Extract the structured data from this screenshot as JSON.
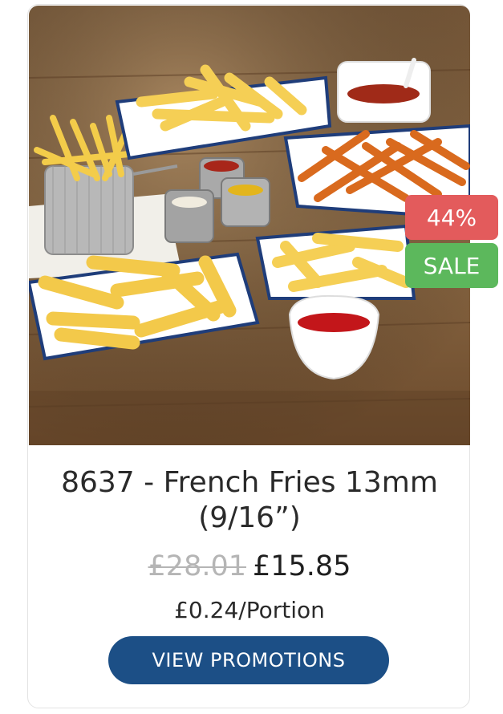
{
  "product": {
    "title": "8637 - French Fries 13mm (9/16”)",
    "old_price": "£28.01",
    "price": "£15.85",
    "per_portion": "£0.24/Portion",
    "discount_badge": "44%",
    "sale_badge": "SALE",
    "cta_label": "VIEW PROMOTIONS",
    "image_alt": "French fries in enamel dishes with dips"
  },
  "colors": {
    "discount_badge": "#e35b5c",
    "sale_badge": "#5cb85c",
    "cta": "#1c4f86",
    "old_price": "#b5b5b5"
  }
}
